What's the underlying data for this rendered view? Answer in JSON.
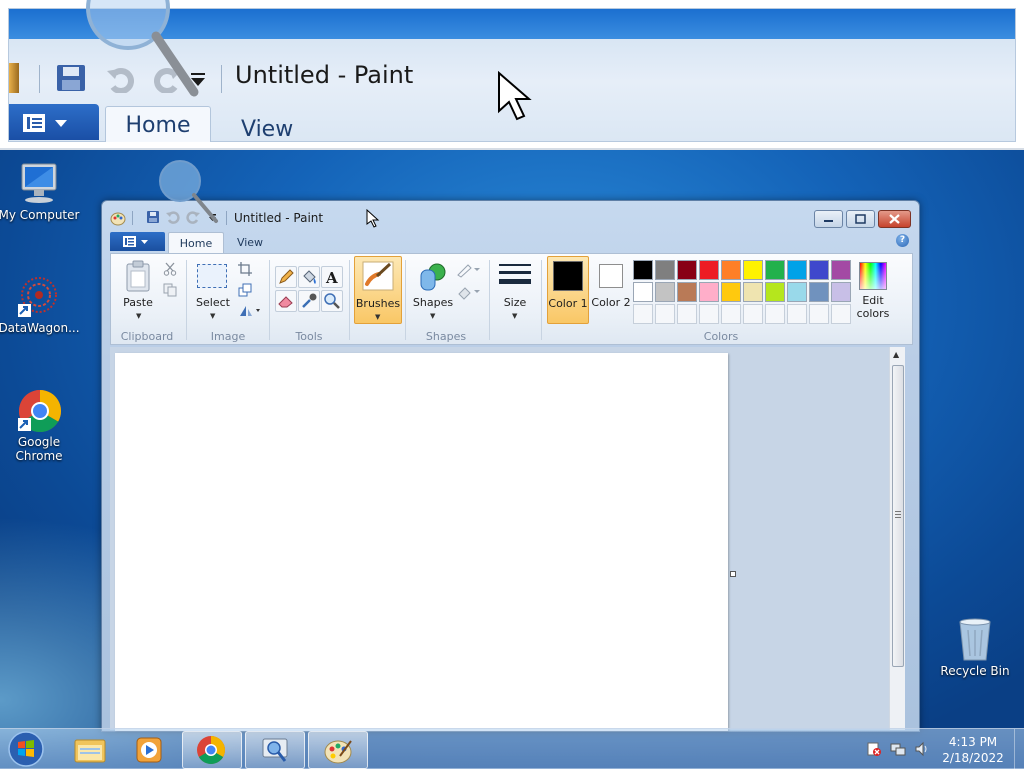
{
  "zoom": {
    "title": "Untitled - Paint",
    "tabs": [
      "Home",
      "View"
    ]
  },
  "desktop": {
    "icons": [
      {
        "label": "My Computer",
        "icon": "computer-icon"
      },
      {
        "label": "DataWagon...",
        "icon": "datawagon-icon"
      },
      {
        "label": "Google Chrome",
        "icon": "chrome-icon"
      },
      {
        "label": "Recycle Bin",
        "icon": "recycle-bin-icon"
      }
    ]
  },
  "window": {
    "title": "Untitled - Paint",
    "tabs": {
      "home": "Home",
      "view": "View"
    },
    "help": "?",
    "ribbon": {
      "clipboard": {
        "paste": "Paste",
        "group": "Clipboard"
      },
      "image": {
        "select": "Select",
        "group": "Image"
      },
      "tools": {
        "group": "Tools"
      },
      "brushes": {
        "label": "Brushes"
      },
      "shapes": {
        "label": "Shapes",
        "group": "Shapes"
      },
      "size": {
        "label": "Size"
      },
      "color1": {
        "label": "Color 1",
        "value": "#000000"
      },
      "color2": {
        "label": "Color 2",
        "value": "#ffffff"
      },
      "colors": {
        "group": "Colors",
        "edit": "Edit colors",
        "row1": [
          "#000000",
          "#7f7f7f",
          "#880015",
          "#ed1c24",
          "#ff7f27",
          "#fff200",
          "#22b14c",
          "#00a2e8",
          "#3f48cc",
          "#a349a4"
        ],
        "row2": [
          "#ffffff",
          "#c3c3c3",
          "#b97a57",
          "#ffaec9",
          "#ffc90e",
          "#efe4b0",
          "#b5e61d",
          "#99d9ea",
          "#7092be",
          "#c8bfe7"
        ]
      }
    }
  },
  "taskbar": {
    "time": "4:13 PM",
    "date": "2/18/2022"
  }
}
